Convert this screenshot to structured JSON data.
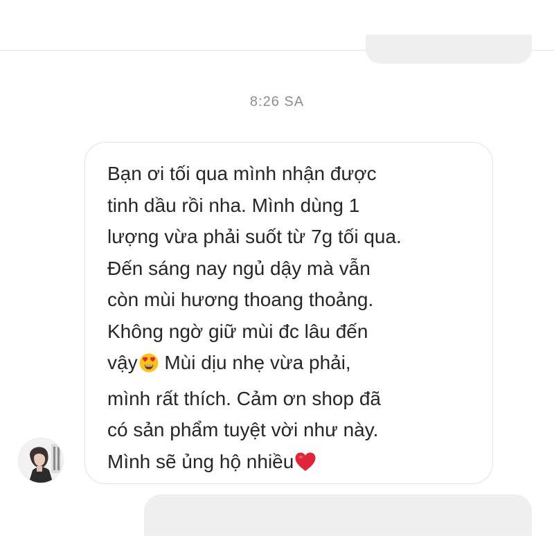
{
  "conversation": {
    "timestamp": "8:26 SA",
    "message": {
      "lines": [
        "Bạn ơi tối qua mình nhận được",
        "tinh dầu rồi nha. Mình dùng 1",
        "lượng vừa phải suốt từ 7g tối qua.",
        "Đến sáng nay ngủ dậy mà vẫn",
        "còn mùi hương thoang thoảng.",
        "Không ngờ giữ mùi đc lâu đến",
        "vậy",
        "Mùi dịu nhẹ vừa phải,",
        "mình rất thích. Cảm ơn shop đã",
        "có sản phẩm tuyệt vời như này.",
        "Mình sẽ ủng hộ nhiều"
      ],
      "emojis": [
        "heart-eyes-emoji",
        "red-heart-emoji"
      ]
    }
  },
  "colors": {
    "background": "#ffffff",
    "timestamp_text": "#8e8e8e",
    "message_text": "#262626",
    "bubble_border": "#e2e2e2",
    "other_bubble_fill": "#efefef",
    "heart": "#e0243a",
    "emoji_face": "#fcc21b"
  }
}
